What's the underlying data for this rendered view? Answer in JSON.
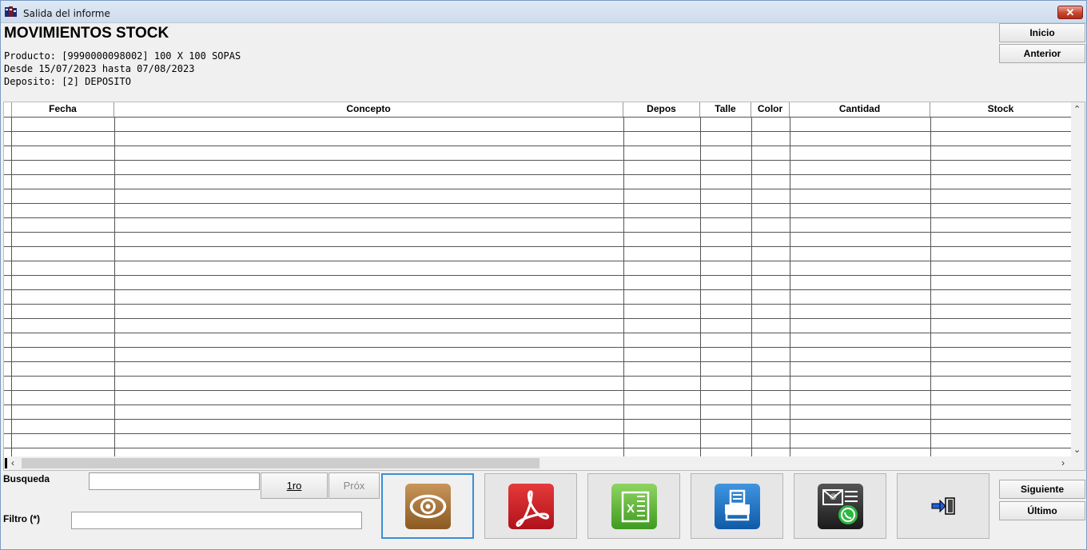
{
  "window": {
    "title": "Salida del informe",
    "close_label": "✕"
  },
  "report": {
    "title": "MOVIMIENTOS STOCK",
    "lines": [
      "Producto: [9990000098002] 100 X 100 SOPAS",
      "Desde 15/07/2023 hasta 07/08/2023",
      "Deposito: [2] DEPOSITO"
    ]
  },
  "nav_side": {
    "inicio": "Inicio",
    "anterior": "Anterior",
    "siguiente": "Siguiente",
    "ultimo": "Último"
  },
  "table": {
    "columns": [
      "Fecha",
      "Concepto",
      "Depos",
      "Talle",
      "Color",
      "Cantidad",
      "Stock"
    ],
    "rows": []
  },
  "search": {
    "busqueda_label": "Busqueda",
    "busqueda_value": "",
    "filtro_label": "Filtro (*)",
    "filtro_value": "",
    "first_label": "1ro",
    "next_label": "Próx"
  },
  "actions": {
    "icons": [
      "eye-icon",
      "pdf-icon",
      "excel-icon",
      "printer-icon",
      "email-whatsapp-icon",
      "exit-icon"
    ]
  },
  "colors": {
    "accent_border": "#3a8fd6",
    "pdf_red": "#c8161d",
    "excel_green": "#4aa82a",
    "print_blue": "#1a6cc0",
    "eye_brown": "#9b6a2a"
  }
}
